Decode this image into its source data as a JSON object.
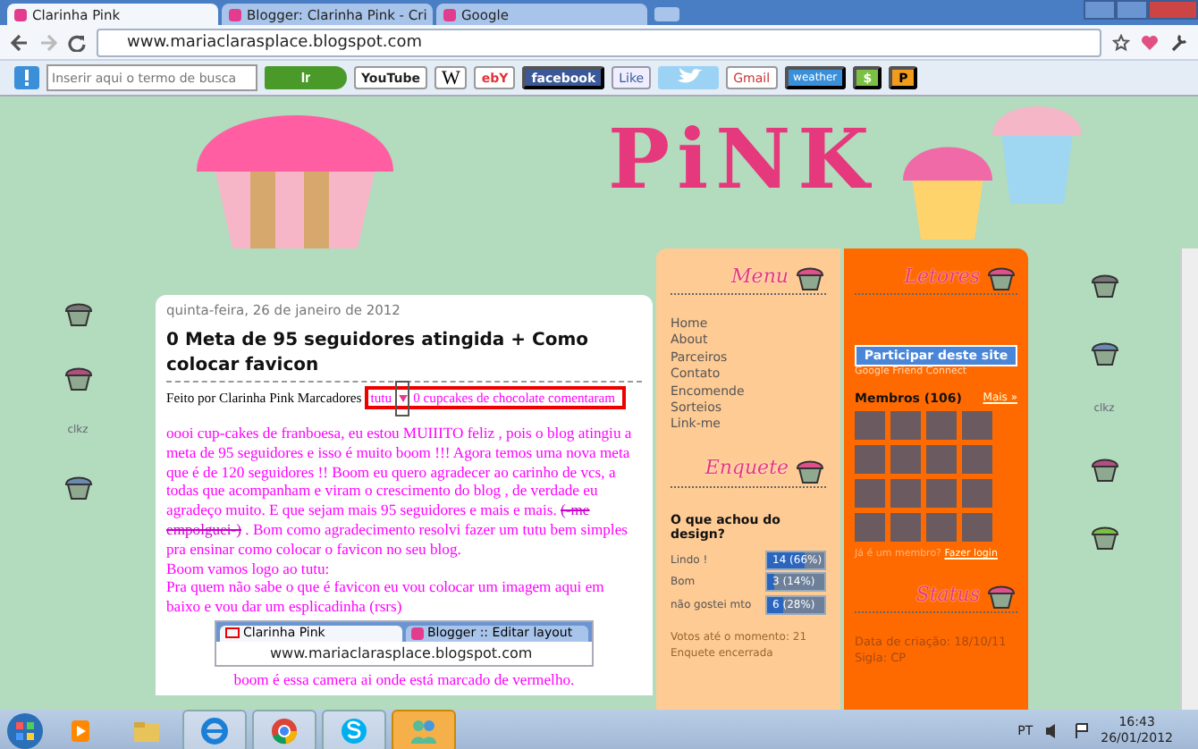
{
  "browser": {
    "tabs": [
      {
        "title": "Clarinha Pink",
        "selected": true
      },
      {
        "title": "Blogger: Clarinha Pink - Cri",
        "selected": false
      },
      {
        "title": "Google",
        "selected": false
      }
    ],
    "url": "www.mariaclarasplace.blogspot.com"
  },
  "toolbar": {
    "search_placeholder": "Inserir aqui o termo de busca",
    "go_button": "Ir",
    "buttons": [
      {
        "kind": "youtube",
        "label": "YouTube"
      },
      {
        "kind": "wiki",
        "label": "W"
      },
      {
        "kind": "ebay",
        "label": "ebY"
      },
      {
        "kind": "facebook",
        "label": "facebook"
      },
      {
        "kind": "like",
        "label": "Like"
      },
      {
        "kind": "bird"
      },
      {
        "kind": "gmail",
        "label": "Gmail"
      },
      {
        "kind": "weather",
        "label": "weather"
      },
      {
        "kind": "dollar",
        "label": "$"
      },
      {
        "kind": "p",
        "label": "P"
      }
    ]
  },
  "blog": {
    "header_title": "PiNK",
    "background_marks": [
      "clkz",
      "clkz"
    ],
    "post": {
      "date": "quinta-feira, 26 de janeiro de 2012",
      "title": "0 Meta de 95 seguidores atingida + Como colocar favicon",
      "byline": "Feito por Clarinha Pink Marcadores",
      "label": "tutu",
      "comments": "0 cupcakes de chocolate comentaram",
      "paragraphs": [
        [
          {
            "text": "oooi cup-cakes de franboesa, eu estou MUIIITO feliz , pois o blog atingiu a meta de 95 seguidores e isso é muito boom !!! Agora temos uma nova meta que é de 120 seguidores !! Boom eu quero agradecer ao carinho de vcs, a todas que acompanham e viram o crescimento do blog , de verdade eu agradeço muito. E que sejam mais 95 seguidores e mais e mais. ",
            "struck": false
          },
          {
            "text": "(-me empolguei-)",
            "struck": true
          },
          {
            "text": " . Bom como agradecimento resolvi fazer um tutu bem simples pra ensinar como colocar o favicon no seu blog.",
            "struck": false
          }
        ],
        [
          {
            "text": "Boom vamos logo ao tutu:",
            "struck": false
          }
        ],
        [
          {
            "text": "Pra quem não sabe o que é favicon eu vou colocar um imagem aqui em baixo e vou dar um esplicadinha (rsrs)",
            "struck": false
          }
        ]
      ],
      "figure": {
        "tabs": [
          {
            "title": "Clarinha Pink",
            "selected": true
          },
          {
            "title": "Blogger :: Editar layout",
            "selected": false
          }
        ],
        "url": "www.mariaclarasplace.blogspot.com"
      },
      "caption": "boom é essa camera ai onde está marcado de vermelho."
    },
    "menu": {
      "heading": "Menu",
      "items": [
        "Home",
        "About",
        "Parceiros",
        "Contato",
        "Encomende",
        "Sorteios",
        "Link-me"
      ]
    },
    "poll": {
      "heading": "Enquete",
      "question": "O que achou do design?",
      "options": [
        {
          "label": "Lindo !",
          "reading": "14 (66%)",
          "level": 0.66
        },
        {
          "label": "Bom",
          "reading": "3 (14%)",
          "level": 0.14
        },
        {
          "label": "não gostei mto",
          "reading": "6 (28%)",
          "level": 0.28
        }
      ],
      "total": "Votos até o momento: 21",
      "status": "Enquete encerrada"
    },
    "followers": {
      "heading": "Letores",
      "join_button": "Participar deste site",
      "provider": "Google Friend Connect",
      "members": "Membros (106)",
      "more_link": "Mais »",
      "login_prompt": "Já é um membro?",
      "login_link": "Fazer login"
    },
    "status": {
      "heading": "Status",
      "lines": [
        "Data de criação: 18/10/11",
        "Sigla: CP"
      ]
    }
  },
  "taskbar": {
    "apps": [
      {
        "kind": "media",
        "active": false
      },
      {
        "kind": "folder",
        "active": false
      },
      {
        "kind": "ie",
        "active": false
      },
      {
        "kind": "chrome",
        "active": false
      },
      {
        "kind": "skype",
        "active": false
      },
      {
        "kind": "messenger",
        "active": true
      }
    ],
    "language": "PT",
    "time": "16:43",
    "date": "26/01/2012"
  }
}
